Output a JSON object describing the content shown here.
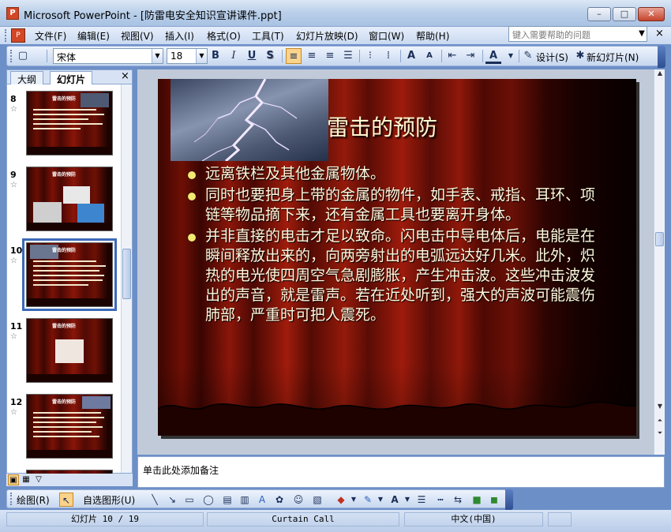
{
  "window": {
    "title": "Microsoft PowerPoint - [防雷电安全知识宣讲课件.ppt]",
    "app_icon_label": "P",
    "minimize": "–",
    "maximize": "□",
    "close": "✕"
  },
  "menu": {
    "items": [
      "文件(F)",
      "编辑(E)",
      "视图(V)",
      "插入(I)",
      "格式(O)",
      "工具(T)",
      "幻灯片放映(D)",
      "窗口(W)",
      "帮助(H)"
    ],
    "help_placeholder": "键入需要帮助的问题",
    "close_label": "×"
  },
  "toolbar": {
    "font_name": "宋体",
    "font_size": "18",
    "bold": "B",
    "italic": "I",
    "underline": "U",
    "shadow": "S",
    "design_label": "设计(S)",
    "new_slide_label": "新幻灯片(N)"
  },
  "left_pane": {
    "tabs": [
      "大纲",
      "幻灯片"
    ],
    "active_tab": "幻灯片",
    "close_label": "×",
    "thumbnails": [
      {
        "number": "8",
        "title": "雷击的预防",
        "selected": false
      },
      {
        "number": "9",
        "title": "雷击的预防",
        "selected": false
      },
      {
        "number": "10",
        "title": "雷击的预防",
        "selected": true
      },
      {
        "number": "11",
        "title": "雷击的预防",
        "selected": false
      },
      {
        "number": "12",
        "title": "雷击的预防",
        "selected": false
      }
    ]
  },
  "slide": {
    "title": "雷击的预防",
    "bullets": [
      "远离铁栏及其他金属物体。",
      "同时也要把身上带的金属的物件，如手表、戒指、耳环、项链等物品摘下来，还有金属工具也要离开身体。",
      "并非直接的电击才足以致命。闪电击中导电体后，电能是在瞬间释放出来的，向两旁射出的电弧远达好几米。此外，炽热的电光使四周空气急剧膨胀，产生冲击波。这些冲击波发出的声音，就是雷声。若在近处听到，强大的声波可能震伤肺部，严重时可把人震死。"
    ]
  },
  "notes": {
    "placeholder": "单击此处添加备注"
  },
  "drawing_toolbar": {
    "draw_label": "绘图(R)",
    "autoshapes_label": "自选图形(U)"
  },
  "status": {
    "slide_position": "幻灯片 10 / 19",
    "design_template": "Curtain Call",
    "language": "中文(中国)"
  },
  "colors": {
    "slide_text": "#fff8dc",
    "bullet": "#f2ea73",
    "chrome": "#c9d9f1",
    "accent_selected": "#3d6ab8"
  }
}
